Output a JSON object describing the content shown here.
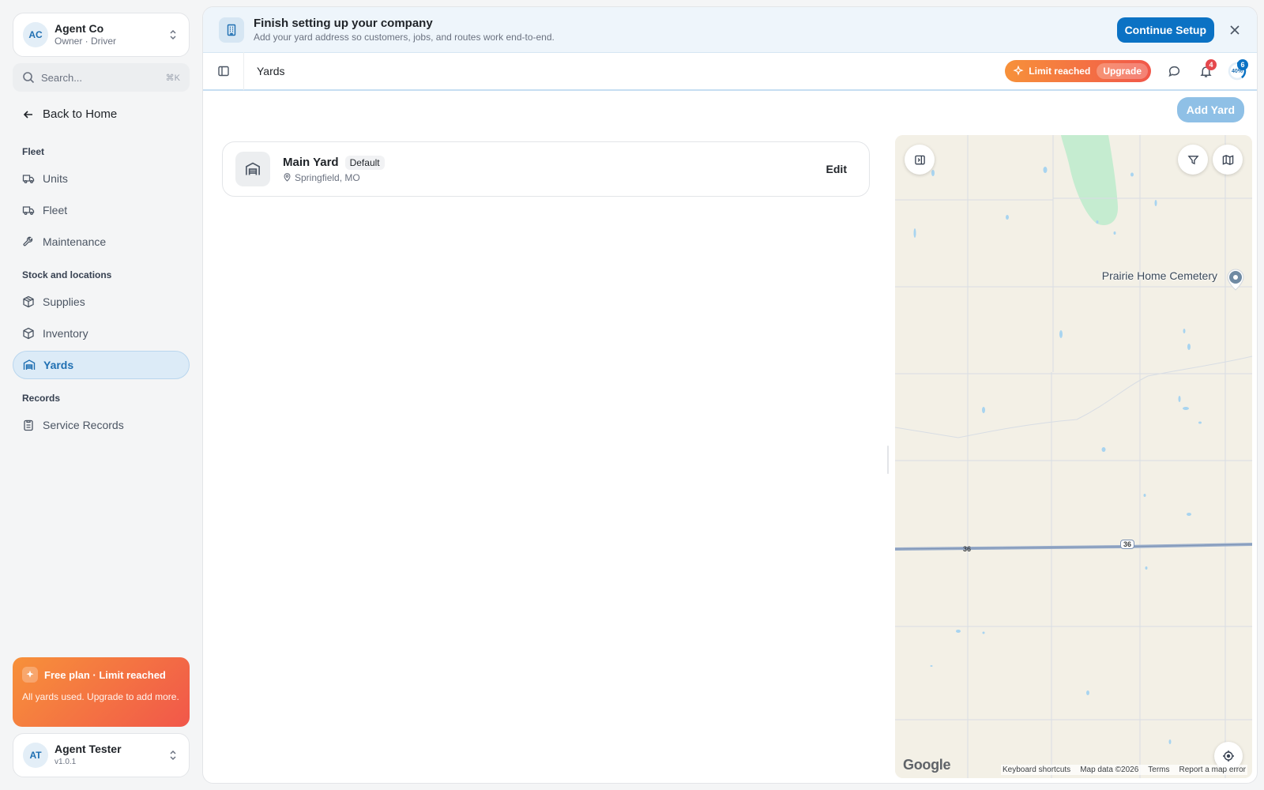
{
  "org": {
    "initials": "AC",
    "name": "Agent Co",
    "role": "Owner · Driver"
  },
  "search": {
    "placeholder": "Search...",
    "shortcut": "⌘K"
  },
  "nav": {
    "back_label": "Back to Home",
    "sections": [
      {
        "label": "Fleet",
        "items": [
          {
            "label": "Units",
            "icon": "truck-icon"
          },
          {
            "label": "Fleet",
            "icon": "truck-icon"
          },
          {
            "label": "Maintenance",
            "icon": "wrench-icon"
          }
        ]
      },
      {
        "label": "Stock and locations",
        "items": [
          {
            "label": "Supplies",
            "icon": "package-icon"
          },
          {
            "label": "Inventory",
            "icon": "box-icon"
          },
          {
            "label": "Yards",
            "icon": "warehouse-icon",
            "active": true
          }
        ]
      },
      {
        "label": "Records",
        "items": [
          {
            "label": "Service Records",
            "icon": "clipboard-icon"
          }
        ]
      }
    ]
  },
  "promo": {
    "title": "Free plan · Limit reached",
    "body": "All yards used. Upgrade to add more."
  },
  "user": {
    "initials": "AT",
    "name": "Agent Tester",
    "version": "v1.0.1"
  },
  "banner": {
    "title": "Finish setting up your company",
    "subtitle": "Add your yard address so customers, jobs, and routes work end-to-end.",
    "cta": "Continue Setup"
  },
  "topbar": {
    "breadcrumb": "Yards",
    "limit_label": "Limit reached",
    "upgrade_label": "Upgrade",
    "notifications_count": "4",
    "setup_count": "6",
    "setup_progress": "40%"
  },
  "page": {
    "add_button": "Add Yard"
  },
  "yards": [
    {
      "name": "Main Yard",
      "badge": "Default",
      "location": "Springfield, MO",
      "action": "Edit"
    }
  ],
  "map": {
    "poi_label": "Prairie Home Cemetery",
    "route_number": "36",
    "logo": "Google",
    "footer": [
      "Keyboard shortcuts",
      "Map data ©2026",
      "Terms",
      "Report a map error"
    ]
  },
  "colors": {
    "accent": "#0b72c4",
    "warning_start": "#f7913a",
    "warning_end": "#f1574a",
    "active_nav_bg": "#dcebf7"
  }
}
